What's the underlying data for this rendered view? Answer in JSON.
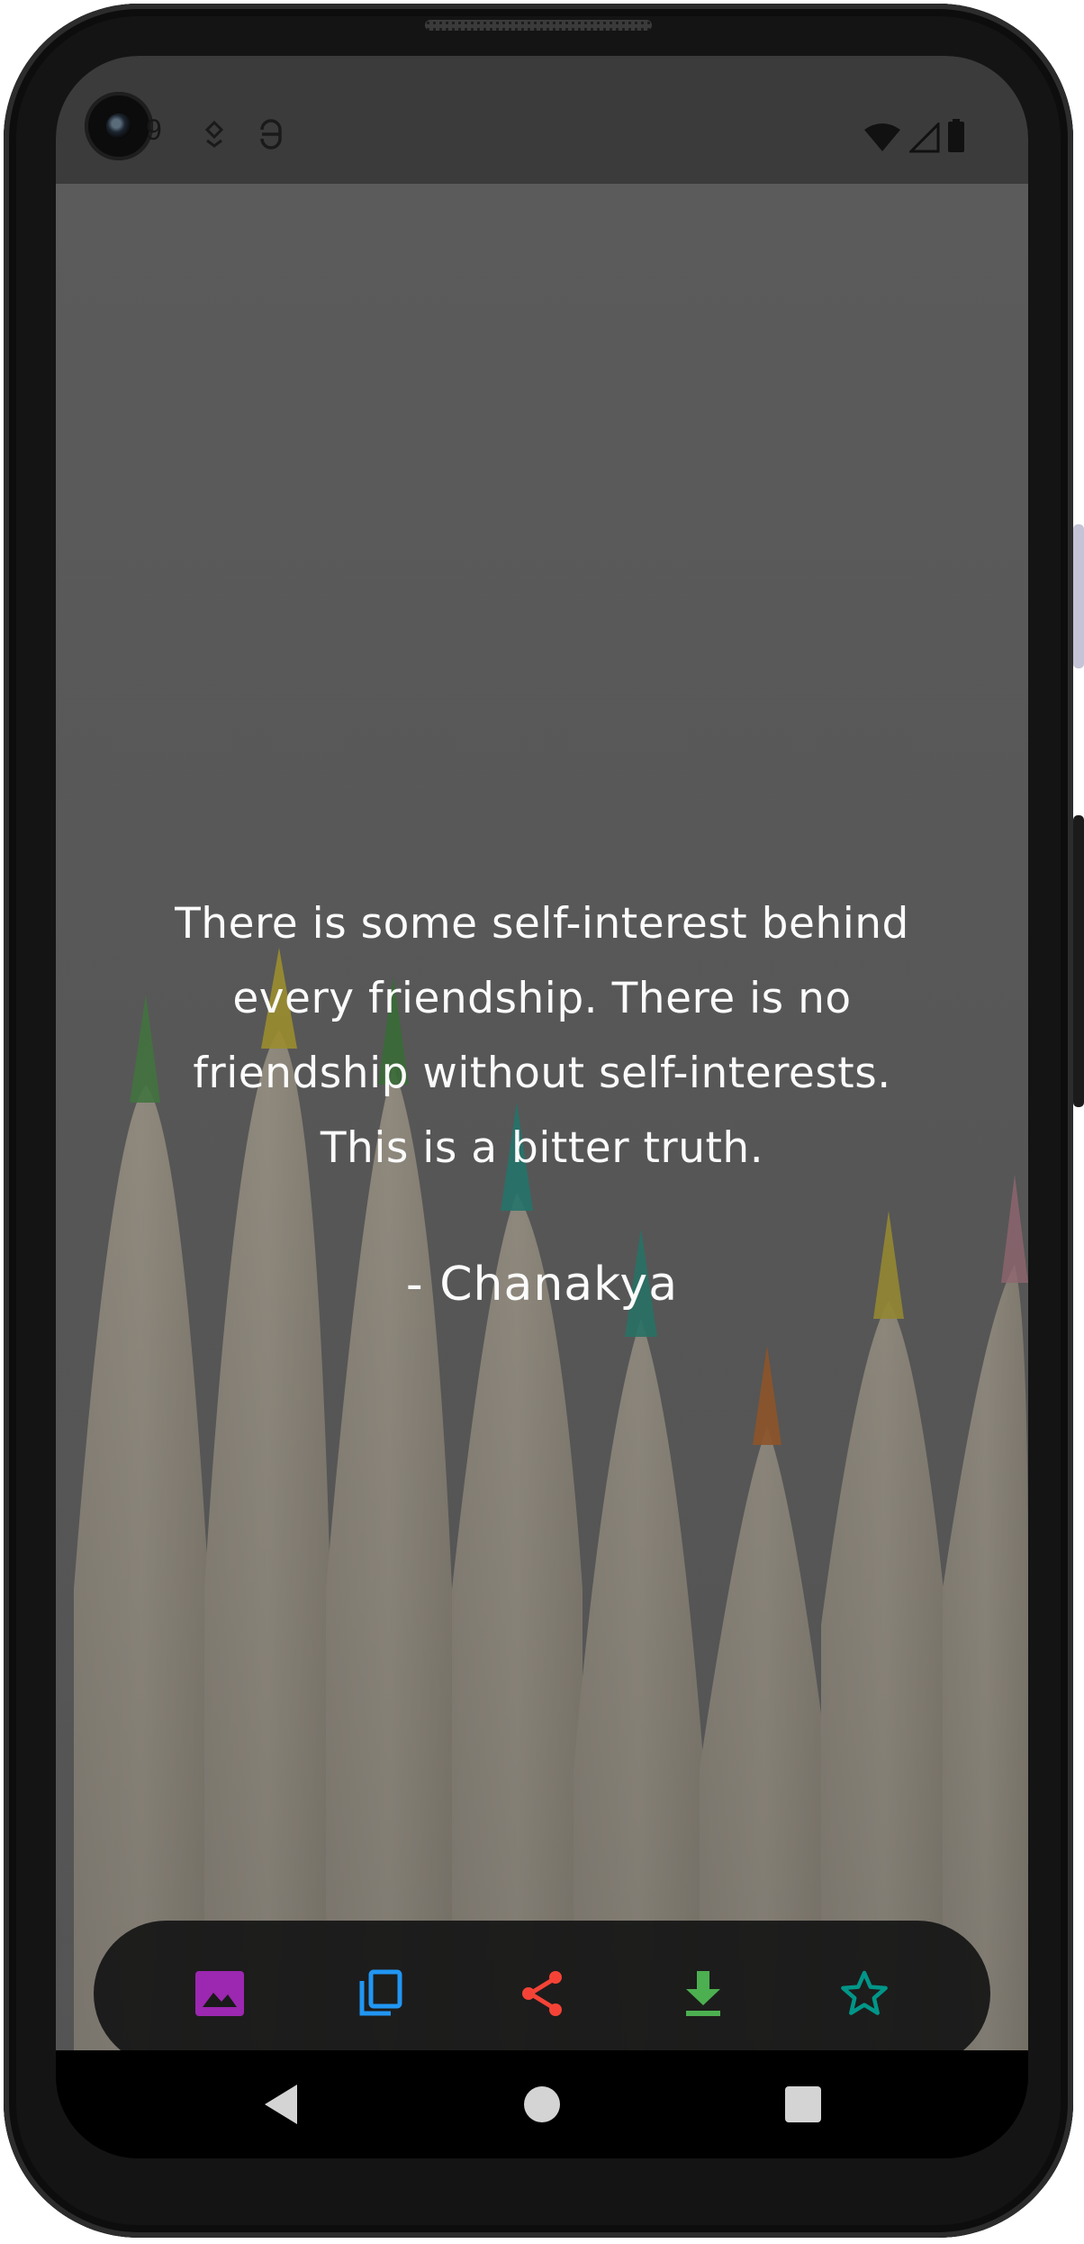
{
  "status_bar": {
    "time_fragment": "9",
    "icons": [
      "notification-icon",
      "vpn-icon",
      "wifi-icon",
      "signal-icon",
      "battery-icon"
    ]
  },
  "quote": {
    "text_lines": [
      "There is some self-interest behind",
      "every friendship. There is no",
      "friendship without self-interests.",
      "This is a bitter truth."
    ],
    "author": "- Chanakya"
  },
  "actions": [
    {
      "name": "wallpaper",
      "icon": "image-icon",
      "color": "#9c27b0"
    },
    {
      "name": "copy",
      "icon": "copy-icon",
      "color": "#2196f3"
    },
    {
      "name": "share",
      "icon": "share-icon",
      "color": "#f44336"
    },
    {
      "name": "download",
      "icon": "download-icon",
      "color": "#4caf50"
    },
    {
      "name": "favorite",
      "icon": "star-icon",
      "color": "#009688"
    }
  ],
  "navigation": [
    "back-icon",
    "home-icon",
    "recents-icon"
  ]
}
